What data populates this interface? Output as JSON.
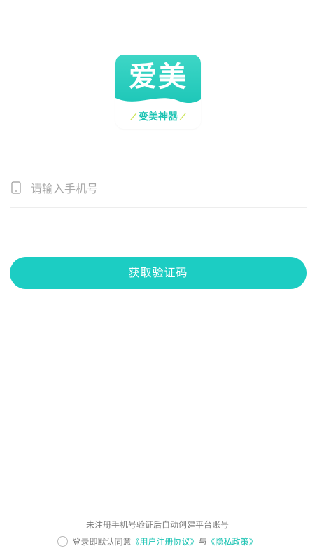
{
  "logo": {
    "title": "爱美",
    "subtitle": "变美神器"
  },
  "login": {
    "phone_placeholder": "请输入手机号",
    "get_code_button": "获取验证码"
  },
  "footer": {
    "note": "未注册手机号验证后自动创建平台账号",
    "agree_prefix": "登录即默认同意",
    "user_agreement": "《用户注册协议》",
    "conjunction": "与",
    "privacy_policy": "《隐私政策》"
  },
  "colors": {
    "accent": "#1ccdc3",
    "link": "#1cc3b3"
  },
  "icons": {
    "phone": "phone-icon",
    "checkbox": "radio-circle-icon"
  }
}
